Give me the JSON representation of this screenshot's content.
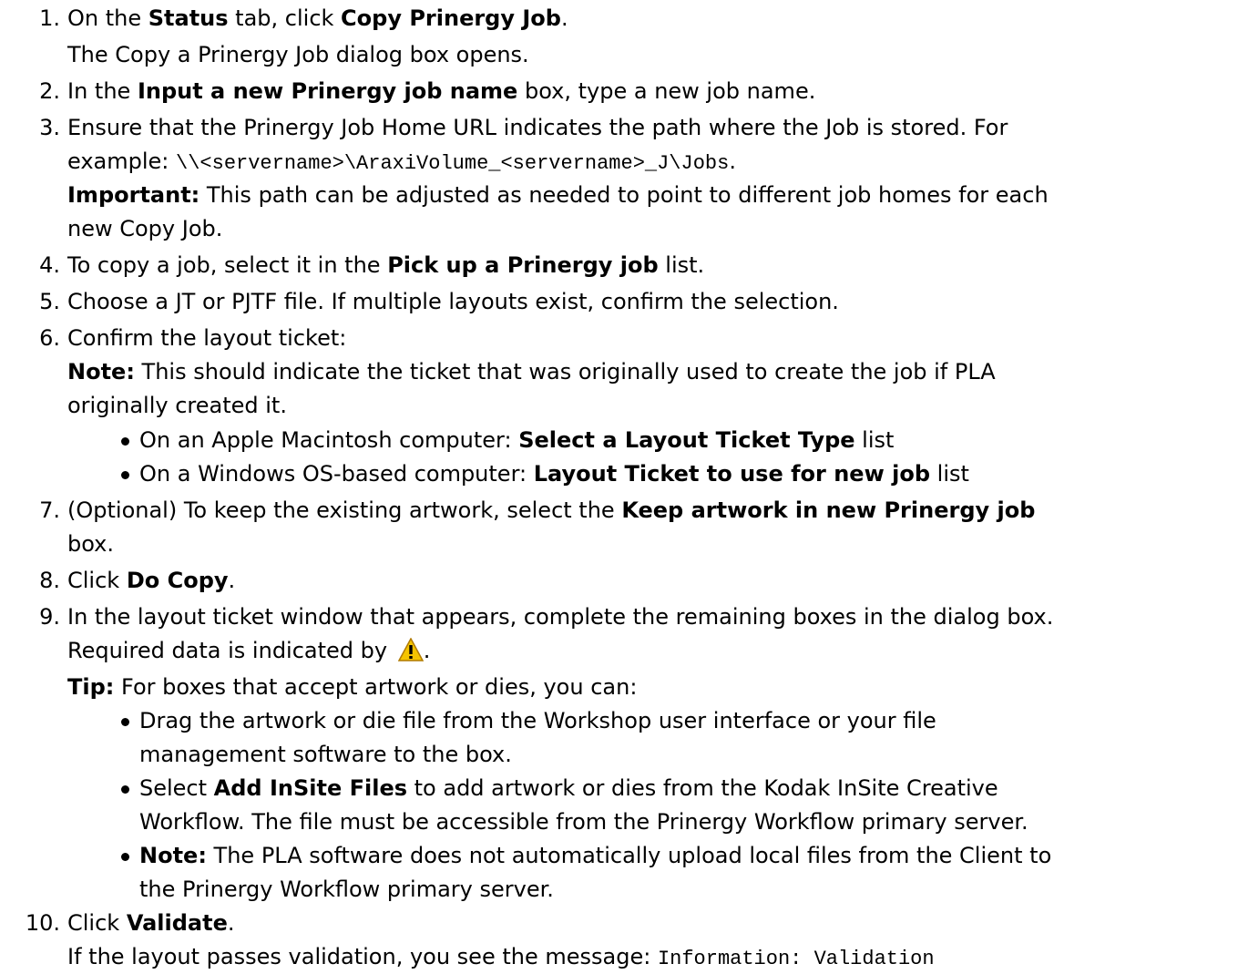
{
  "steps": [
    {
      "num": "1.",
      "lines": [
        {
          "pre": "On the ",
          "b1": "Status",
          "mid": " tab, click ",
          "b2": "Copy Prinergy Job",
          "post": "."
        },
        {
          "text": "The Copy a Prinergy Job dialog box opens."
        }
      ]
    },
    {
      "num": "2.",
      "lines": [
        {
          "pre": "In the ",
          "b1": "Input a new Prinergy job name",
          "post": " box, type a new job name."
        }
      ]
    },
    {
      "num": "3.",
      "lines": [
        {
          "text": "Ensure that the Prinergy Job Home URL indicates the path where the Job is stored. For"
        },
        {
          "pre": "example: ",
          "code": "\\\\<servername>\\AraxiVolume_<servername>_J\\Jobs",
          "post": "."
        },
        {
          "b1": "Important:",
          "post": " This  path can be adjusted as needed to point to different job homes for each"
        },
        {
          "text": "new Copy Job."
        }
      ]
    },
    {
      "num": "4.",
      "lines": [
        {
          "pre": "To copy a job, select it in the ",
          "b1": "Pick up a Prinergy job",
          "post": " list."
        }
      ]
    },
    {
      "num": "5.",
      "lines": [
        {
          "text": "Choose a JT or PJTF file. If multiple layouts exist, confirm the selection."
        }
      ]
    },
    {
      "num": "6.",
      "lines": [
        {
          "text": "Confirm the layout ticket:"
        },
        {
          "b1": "Note:",
          "post": " This should indicate the ticket that was originally used to create the job if PLA"
        },
        {
          "text": "originally created it."
        }
      ],
      "bullets": [
        {
          "pre": "On an Apple Macintosh computer: ",
          "b1": "Select a Layout Ticket Type",
          "post": " list"
        },
        {
          "pre": "On a Windows OS-based computer: ",
          "b1": "Layout Ticket to use for new job",
          "post": " list"
        }
      ]
    },
    {
      "num": "7.",
      "lines": [
        {
          "pre": "(Optional) To keep the existing artwork, select the ",
          "b1": "Keep artwork in new Prinergy job"
        },
        {
          "text": " box."
        }
      ]
    },
    {
      "num": "8.",
      "lines": [
        {
          "pre": "Click ",
          "b1": "Do Copy",
          "post": "."
        }
      ]
    },
    {
      "num": "9.",
      "lines": [
        {
          "text": "In the layout ticket window that appears, complete the remaining boxes in the dialog box."
        },
        {
          "pre": "Required data is indicated by ",
          "post": "."
        },
        {
          "b1": "Tip:",
          "post": " For boxes that accept artwork or dies, you can:"
        }
      ],
      "bullets": [
        {
          "l1": "Drag the artwork or die file from the Workshop user interface or your file",
          "l2": "management software to the box."
        },
        {
          "pre": "Select ",
          "b1": "Add InSite Files",
          "post": " to add artwork or dies from the Kodak InSite Creative",
          "l2": "Workflow. The file must be accessible from the Prinergy Workflow primary server."
        },
        {
          "b1": "Note:",
          "post": " The PLA software does not automatically upload local files from the Client to",
          "l2": "the Prinergy Workflow primary server."
        }
      ]
    },
    {
      "num": "10.",
      "lines": [
        {
          "pre": "Click ",
          "b1": "Validate",
          "post": "."
        },
        {
          "pre": "If the layout passes validation, you see the message: ",
          "code": "Information: Validation"
        }
      ]
    }
  ],
  "icons": {
    "warning": "warning-icon",
    "warning_color": "#f5c400"
  }
}
